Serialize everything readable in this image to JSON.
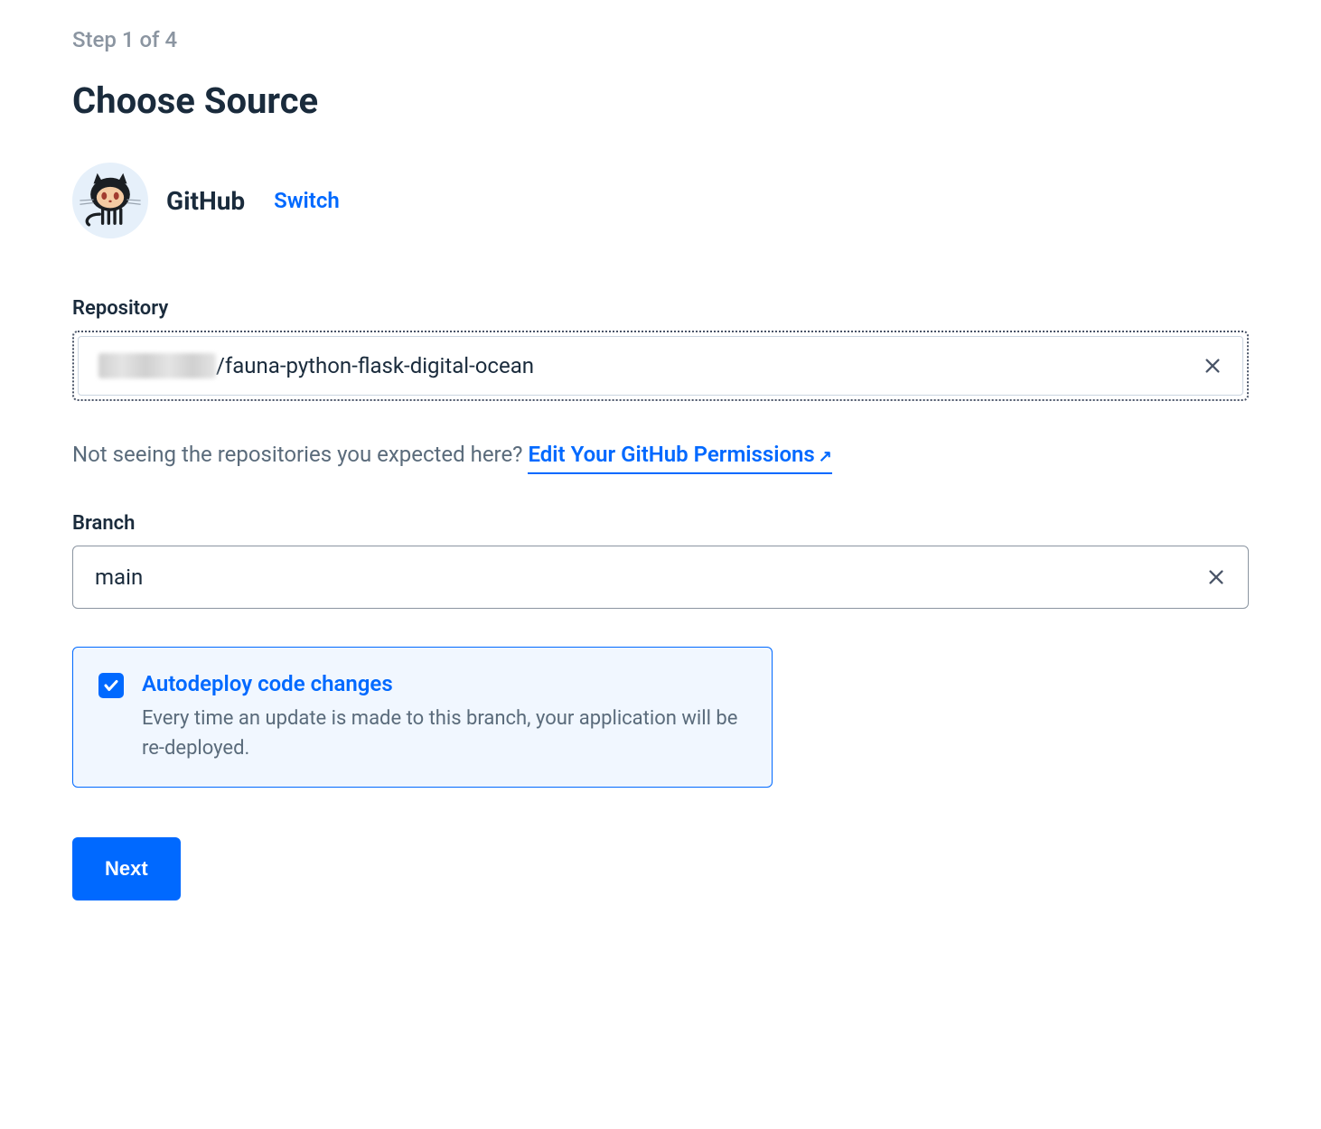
{
  "step_indicator": "Step 1 of 4",
  "page_title": "Choose Source",
  "source": {
    "provider": "GitHub",
    "switch_label": "Switch"
  },
  "repository": {
    "label": "Repository",
    "value_prefix": "",
    "value_suffix": "/fauna-python-flask-digital-ocean"
  },
  "permissions_help": {
    "text": "Not seeing the repositories you expected here? ",
    "link_text": "Edit Your GitHub Permissions",
    "external_icon": "↗"
  },
  "branch": {
    "label": "Branch",
    "value": "main"
  },
  "autodeploy": {
    "checked": true,
    "title": "Autodeploy code changes",
    "description": "Every time an update is made to this branch, your application will be re-deployed."
  },
  "next_button": "Next"
}
